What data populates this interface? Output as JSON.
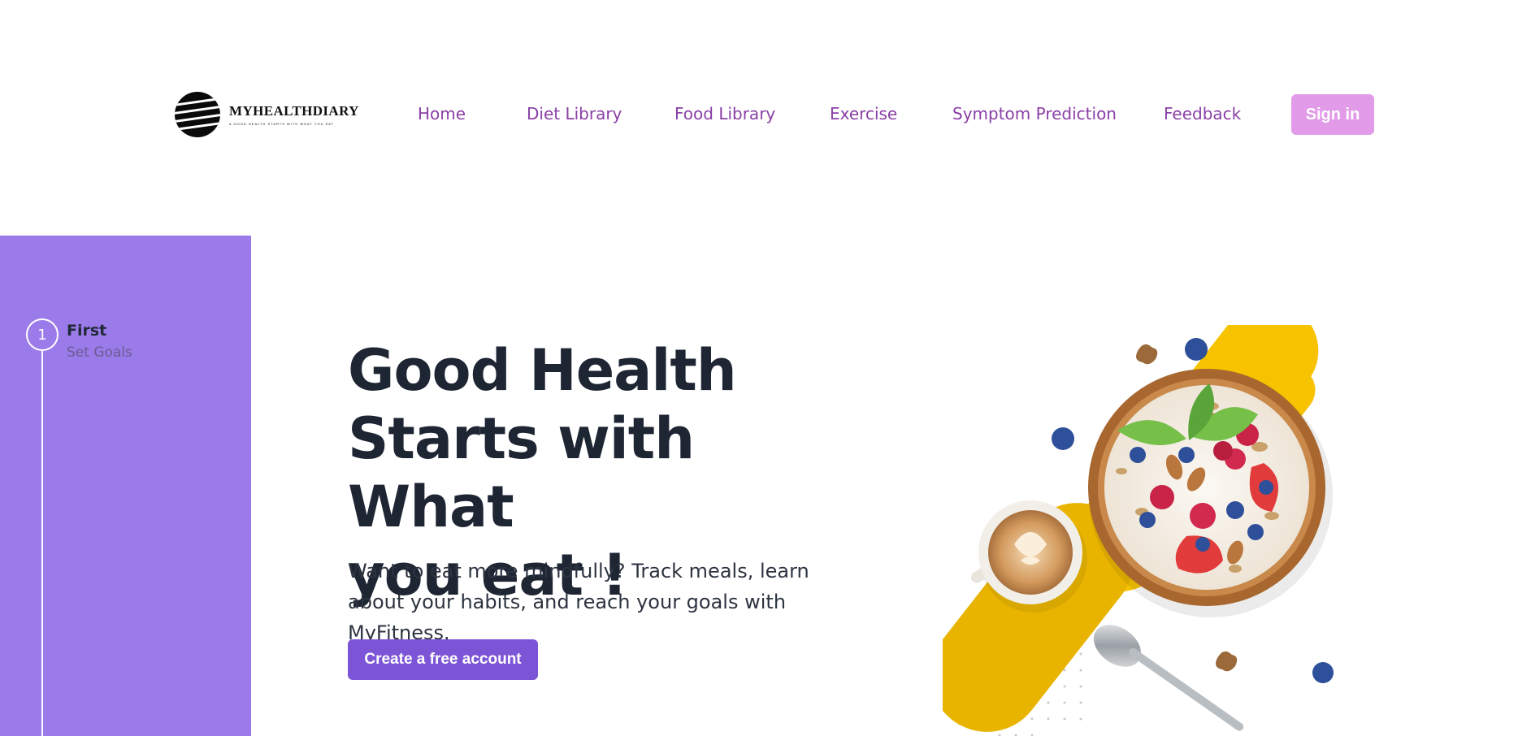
{
  "brand": {
    "name": "MYHEALTHDIARY",
    "tagline": "A GOOD HEALTH STARTS WITH WHAT YOU EAT"
  },
  "nav": {
    "items": [
      {
        "label": "Home"
      },
      {
        "label": "Diet Library"
      },
      {
        "label": "Food Library"
      },
      {
        "label": "Exercise"
      },
      {
        "label": "Symptom Prediction"
      },
      {
        "label": "Feedback"
      }
    ],
    "signin_label": "Sign in"
  },
  "steps": {
    "items": [
      {
        "number": "1",
        "title": "First",
        "subtitle": "Set Goals"
      }
    ]
  },
  "hero": {
    "title_line1": "Good Health",
    "title_line2": "Starts with What",
    "title_line3": "you eat !",
    "description": "Want to eat more mindfully? Track meals, learn about your habits, and reach your goals with MyFitness.",
    "cta_label": "Create a free account"
  },
  "colors": {
    "nav_link": "#8a3fa6",
    "signin_bg": "#e29be9",
    "sidebar_bg": "#9b7ae9",
    "cta_bg": "#7c55d6",
    "heading": "#1e2533",
    "accent_yellow": "#f7c300"
  },
  "icons": {
    "logo": "striped-globe-icon",
    "illustration": "breakfast-bowl-illustration"
  }
}
